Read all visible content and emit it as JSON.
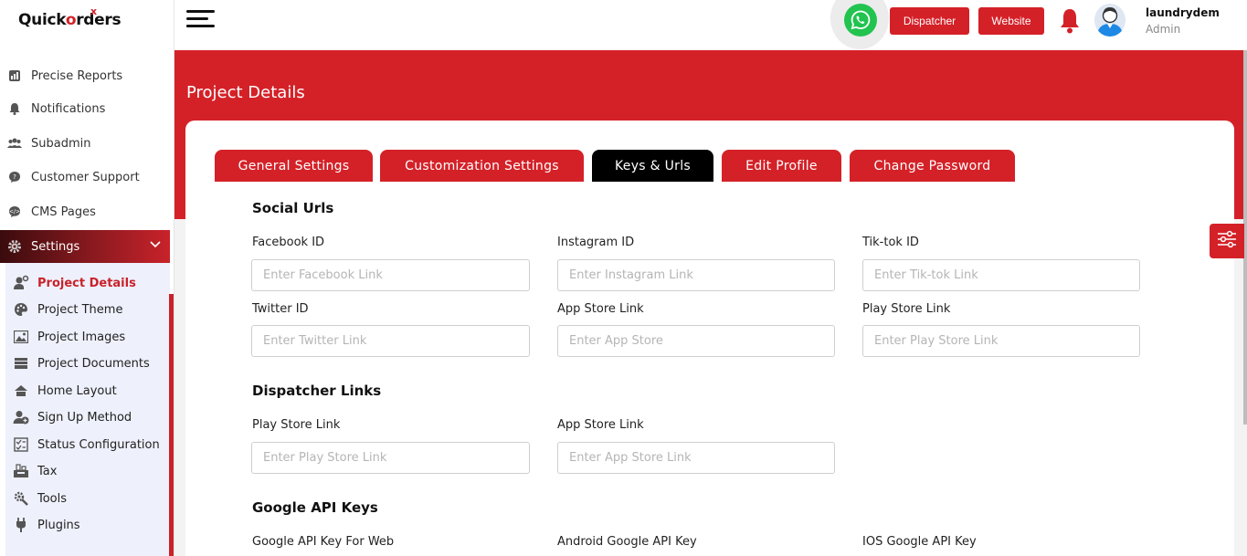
{
  "app": {
    "logo_pre": "Quick",
    "logo_o": "o",
    "logo_post": "rders",
    "logo_x": "x"
  },
  "sidebar": {
    "items": [
      {
        "label": "Precise Reports",
        "icon": "report-icon"
      },
      {
        "label": "Notifications",
        "icon": "bell-icon"
      },
      {
        "label": "Subadmin",
        "icon": "users-icon"
      },
      {
        "label": "Customer Support",
        "icon": "chat-icon"
      },
      {
        "label": "CMS Pages",
        "icon": "code-chat-icon"
      },
      {
        "label": "Settings",
        "icon": "gear-icon"
      }
    ],
    "submenu": [
      {
        "label": "Project Details",
        "icon": "user-gear-icon"
      },
      {
        "label": "Project Theme",
        "icon": "palette-icon"
      },
      {
        "label": "Project Images",
        "icon": "image-icon"
      },
      {
        "label": "Project Documents",
        "icon": "folder-icon"
      },
      {
        "label": "Home Layout",
        "icon": "home-icon"
      },
      {
        "label": "Sign Up Method",
        "icon": "user-plus-icon"
      },
      {
        "label": "Status Configuration",
        "icon": "checklist-icon"
      },
      {
        "label": "Tax",
        "icon": "tax-icon"
      },
      {
        "label": "Tools",
        "icon": "tools-icon"
      },
      {
        "label": "Plugins",
        "icon": "plug-icon"
      }
    ]
  },
  "header": {
    "dispatcher_label": "Dispatcher",
    "website_label": "Website",
    "user_name": "laundrydem",
    "user_role": "Admin"
  },
  "page": {
    "title": "Project Details"
  },
  "tabs": [
    {
      "label": "General Settings"
    },
    {
      "label": "Customization Settings"
    },
    {
      "label": "Keys & Urls"
    },
    {
      "label": "Edit Profile"
    },
    {
      "label": "Change Password"
    }
  ],
  "sections": {
    "social": {
      "title": "Social Urls",
      "fields": [
        {
          "label": "Facebook ID",
          "placeholder": "Enter Facebook Link"
        },
        {
          "label": "Instagram ID",
          "placeholder": "Enter Instagram Link"
        },
        {
          "label": "Tik-tok ID",
          "placeholder": "Enter Tik-tok Link"
        },
        {
          "label": "Twitter ID",
          "placeholder": "Enter Twitter Link"
        },
        {
          "label": "App Store Link",
          "placeholder": "Enter App Store"
        },
        {
          "label": "Play Store Link",
          "placeholder": "Enter Play Store Link"
        }
      ]
    },
    "dispatcher": {
      "title": "Dispatcher Links",
      "fields": [
        {
          "label": "Play Store Link",
          "placeholder": "Enter Play Store Link"
        },
        {
          "label": "App Store Link",
          "placeholder": "Enter App Store Link"
        }
      ]
    },
    "google": {
      "title": "Google API Keys",
      "fields": [
        {
          "label": "Google API Key For Web"
        },
        {
          "label": "Android Google API Key"
        },
        {
          "label": "IOS Google API Key"
        }
      ]
    }
  },
  "colors": {
    "brand_red": "#d42128",
    "active_tab": "#000000",
    "whatsapp": "#22c34f"
  }
}
